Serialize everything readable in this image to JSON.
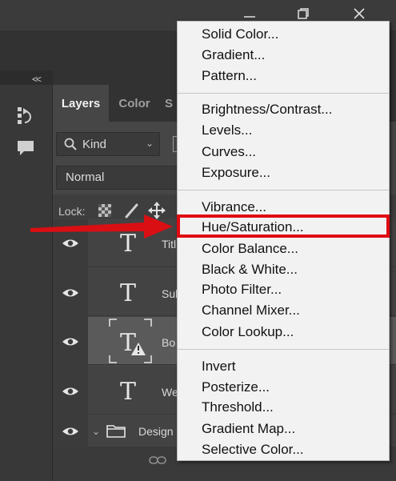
{
  "window": {
    "controls": [
      "minimize-icon",
      "restore-icon",
      "close-icon"
    ]
  },
  "side_rail": {
    "collapse": "<<",
    "tools": [
      "history-brush-icon",
      "comment-icon"
    ]
  },
  "panel": {
    "tabs": [
      {
        "label": "Layers",
        "active": true
      },
      {
        "label": "Color",
        "active": false
      },
      {
        "label": "S",
        "active": false
      }
    ],
    "filter": {
      "label": "Kind"
    },
    "blend_mode": {
      "label": "Normal"
    },
    "lock": {
      "label": "Lock:"
    },
    "layers": [
      {
        "name": "Titl",
        "kind": "text",
        "visible": true,
        "selected": false,
        "warning": false
      },
      {
        "name": "Sub",
        "kind": "text",
        "visible": true,
        "selected": false,
        "warning": false
      },
      {
        "name": "Bo",
        "kind": "text",
        "visible": true,
        "selected": true,
        "warning": true
      },
      {
        "name": "We",
        "kind": "text",
        "visible": true,
        "selected": false,
        "warning": false
      },
      {
        "name": "Design",
        "kind": "group",
        "visible": true,
        "selected": false,
        "warning": false
      }
    ]
  },
  "menu": {
    "groups": [
      [
        "Solid Color...",
        "Gradient...",
        "Pattern..."
      ],
      [
        "Brightness/Contrast...",
        "Levels...",
        "Curves...",
        "Exposure..."
      ],
      [
        "Vibrance...",
        "Hue/Saturation...",
        "Color Balance...",
        "Black & White...",
        "Photo Filter...",
        "Channel Mixer...",
        "Color Lookup..."
      ],
      [
        "Invert",
        "Posterize...",
        "Threshold...",
        "Gradient Map...",
        "Selective Color..."
      ]
    ],
    "highlighted": "Hue/Saturation..."
  },
  "colors": {
    "highlight": "#e00a12",
    "arrow": "#d90f14",
    "menu_bg": "#f2f2f2",
    "panel_bg": "#464646"
  }
}
